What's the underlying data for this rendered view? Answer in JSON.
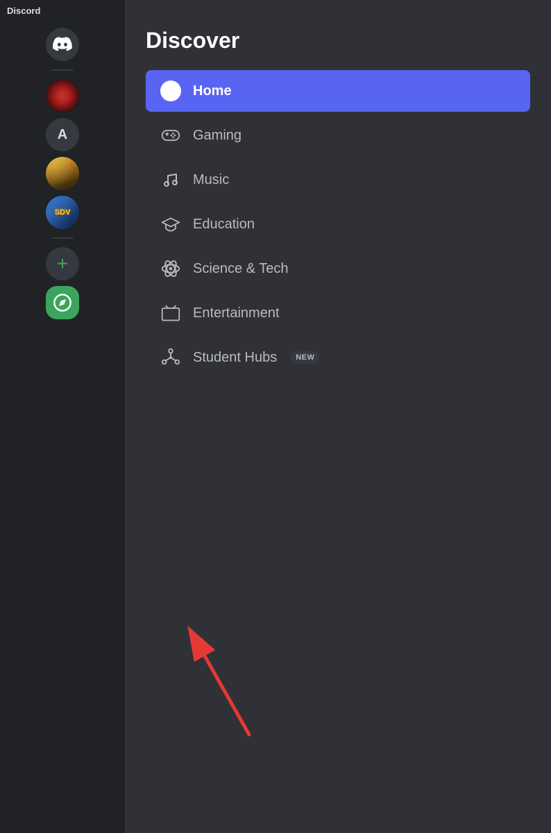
{
  "app": {
    "title": "Discord"
  },
  "sidebar": {
    "items": [
      {
        "id": "discord-home",
        "type": "discord-logo",
        "label": "Discord Home"
      },
      {
        "id": "blurred-red",
        "type": "blurred",
        "label": "Server 1"
      },
      {
        "id": "letter-a",
        "type": "letter",
        "label": "A",
        "text": "A"
      },
      {
        "id": "game-avatar",
        "type": "avatar",
        "label": "Game Avatar"
      },
      {
        "id": "sdv-avatar",
        "type": "sdv",
        "label": "SDV",
        "text": "SDV"
      },
      {
        "id": "add-server",
        "type": "add",
        "label": "Add Server",
        "text": "+"
      },
      {
        "id": "discover",
        "type": "discover",
        "label": "Explore Public Servers"
      }
    ]
  },
  "main": {
    "title": "Discover",
    "nav_items": [
      {
        "id": "home",
        "label": "Home",
        "icon": "compass",
        "active": true
      },
      {
        "id": "gaming",
        "label": "Gaming",
        "icon": "gamepad",
        "active": false
      },
      {
        "id": "music",
        "label": "Music",
        "icon": "music-note",
        "active": false
      },
      {
        "id": "education",
        "label": "Education",
        "icon": "graduation-cap",
        "active": false
      },
      {
        "id": "science-tech",
        "label": "Science & Tech",
        "icon": "atom",
        "active": false
      },
      {
        "id": "entertainment",
        "label": "Entertainment",
        "icon": "tv",
        "active": false
      },
      {
        "id": "student-hubs",
        "label": "Student Hubs",
        "icon": "network",
        "active": false,
        "badge": "NEW"
      }
    ]
  },
  "colors": {
    "active_bg": "#5865f2",
    "sidebar_bg": "#202225",
    "main_bg": "#2f3136",
    "text_primary": "#ffffff",
    "text_secondary": "#b9bbbe",
    "add_color": "#3ba55d",
    "discover_bg": "#3ba55d"
  }
}
